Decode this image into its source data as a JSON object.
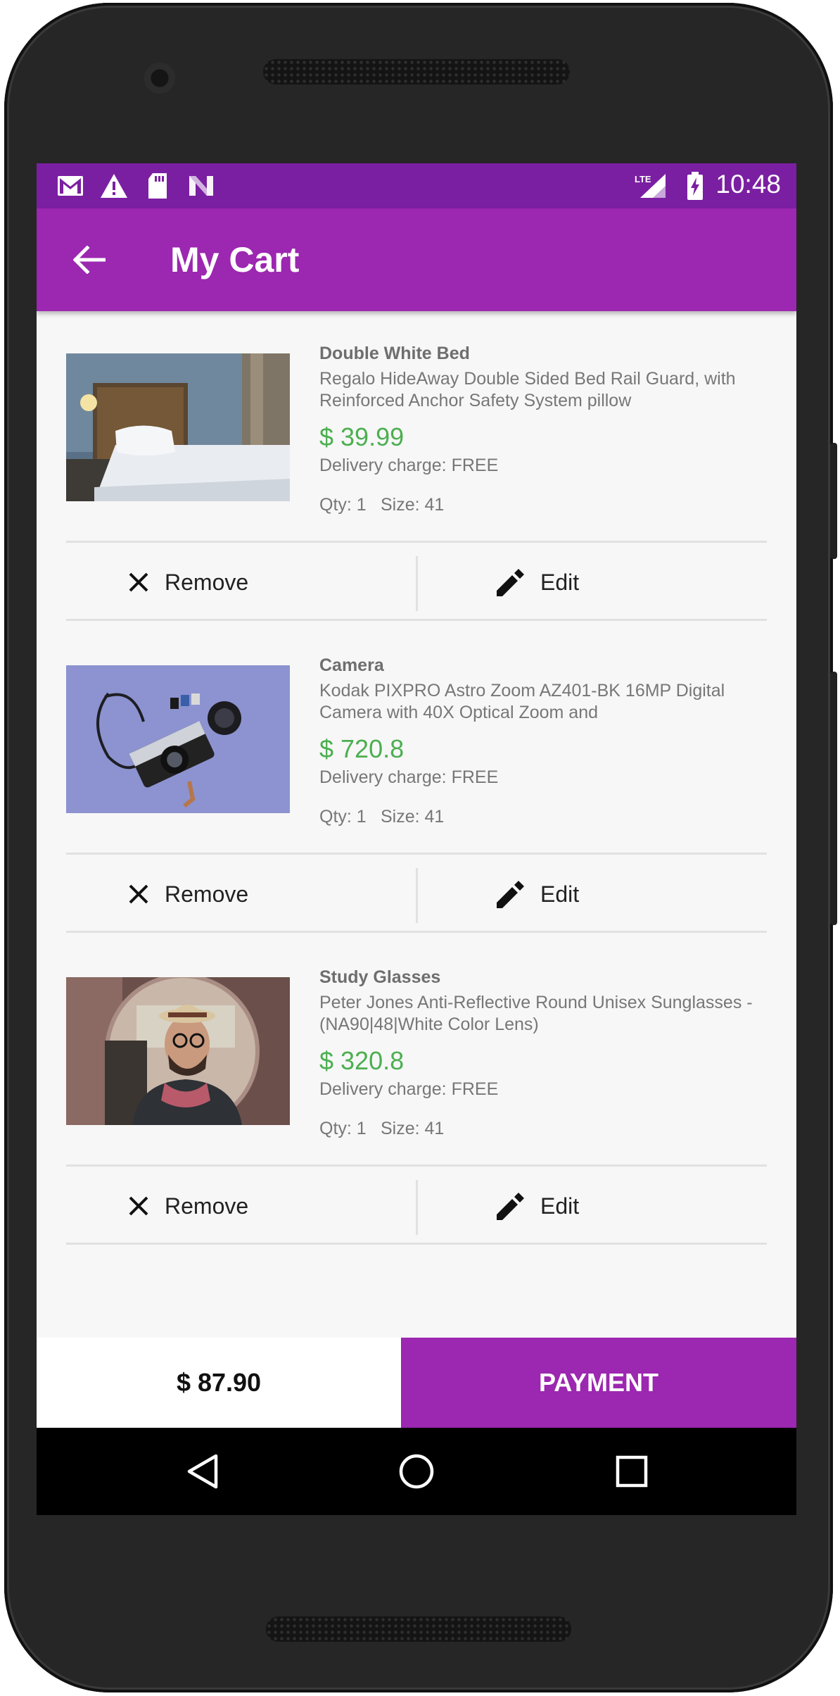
{
  "status_bar": {
    "time": "10:48",
    "left_icons": [
      "gmail-icon",
      "warning-icon",
      "sd-card-icon",
      "android-n-icon"
    ],
    "right_icons": [
      "lte-signal-icon",
      "battery-charging-icon"
    ],
    "network_label": "LTE"
  },
  "app_bar": {
    "title": "My Cart",
    "back_icon": "arrow-back-icon"
  },
  "items": [
    {
      "name": "Double White Bed",
      "description": "Regalo HideAway Double Sided Bed Rail Guard, with Reinforced Anchor Safety System pillow",
      "price": "$ 39.99",
      "delivery": "Delivery charge: FREE",
      "qty": "Qty: 1",
      "size": "Size: 41",
      "image": "bedroom-photo"
    },
    {
      "name": "Camera",
      "description": "Kodak PIXPRO Astro Zoom AZ401-BK 16MP Digital Camera with 40X Optical Zoom and",
      "price": "$ 720.8",
      "delivery": "Delivery charge: FREE",
      "qty": "Qty: 1",
      "size": "Size: 41",
      "image": "camera-photo"
    },
    {
      "name": "Study Glasses",
      "description": "Peter Jones Anti-Reflective Round Unisex Sunglasses - (NA90|48|White Color Lens)",
      "price": "$ 320.8",
      "delivery": "Delivery charge: FREE",
      "qty": "Qty: 1",
      "size": "Size: 41",
      "image": "man-with-glasses-photo"
    }
  ],
  "actions": {
    "remove_label": "Remove",
    "edit_label": "Edit"
  },
  "footer": {
    "total": "$ 87.90",
    "payment_label": "PAYMENT"
  },
  "colors": {
    "primary": "#9c27b0",
    "primary_dark": "#7b1fa2",
    "price_green": "#4caf50"
  },
  "nav_bar": [
    "back-nav-icon",
    "home-nav-icon",
    "recents-nav-icon"
  ]
}
